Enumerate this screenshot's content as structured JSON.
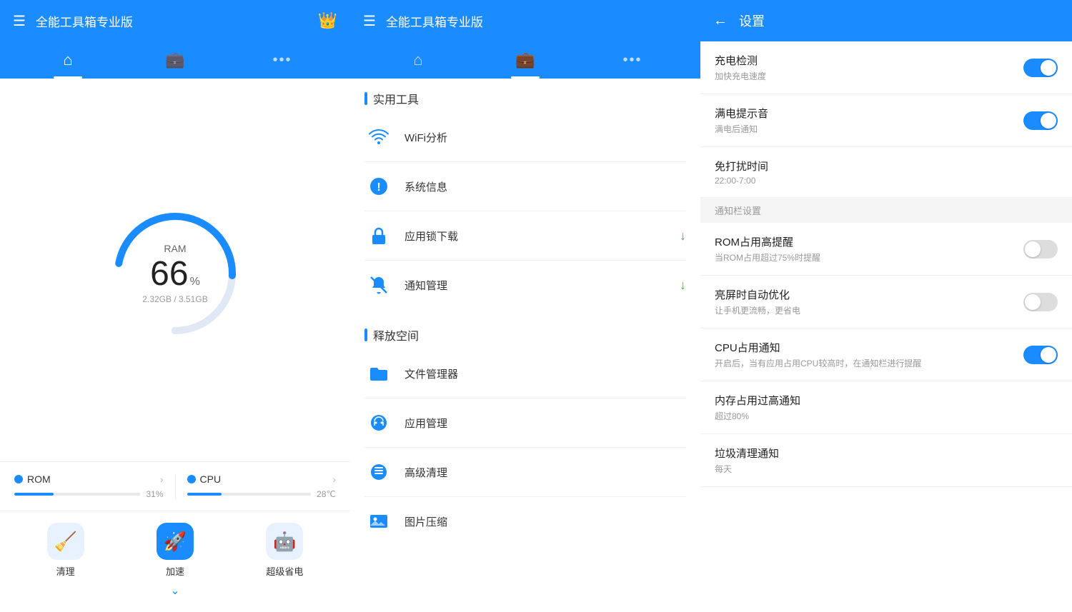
{
  "panel1": {
    "title": "全能工具箱专业版",
    "crown_icon": "👑",
    "nav": {
      "home_label": "home",
      "tools_label": "tools",
      "more_label": "more"
    },
    "ram": {
      "label": "RAM",
      "percent": "66",
      "unit": "%",
      "used": "2.32GB",
      "total": "3.51GB",
      "memory_text": "2.32GB / 3.51GB"
    },
    "rom": {
      "label": "ROM",
      "percent": 31,
      "percent_text": "31%"
    },
    "cpu": {
      "label": "CPU",
      "value": "28",
      "unit": "℃"
    },
    "actions": [
      {
        "id": "clean",
        "label": "清理",
        "icon": "🧹"
      },
      {
        "id": "speed",
        "label": "加速",
        "icon": "🚀",
        "accent": true
      },
      {
        "id": "power",
        "label": "超级省电",
        "icon": "🤖"
      }
    ]
  },
  "panel2": {
    "title": "全能工具箱专业版",
    "sections": [
      {
        "id": "utilities",
        "title": "实用工具",
        "items": [
          {
            "id": "wifi",
            "name": "WiFi分析",
            "icon": "wifi",
            "badge": null
          },
          {
            "id": "sysinfo",
            "name": "系统信息",
            "icon": "info",
            "badge": null
          },
          {
            "id": "applock",
            "name": "应用锁下载",
            "icon": "lock",
            "badge": "download"
          },
          {
            "id": "notify",
            "name": "通知管理",
            "icon": "bell-off",
            "badge": "download"
          }
        ]
      },
      {
        "id": "storage",
        "title": "释放空间",
        "items": [
          {
            "id": "files",
            "name": "文件管理器",
            "icon": "folder",
            "badge": null
          },
          {
            "id": "apps",
            "name": "应用管理",
            "icon": "android",
            "badge": null
          },
          {
            "id": "clean",
            "name": "高级清理",
            "icon": "cleaner",
            "badge": null
          },
          {
            "id": "image",
            "name": "图片压缩",
            "icon": "image",
            "badge": null
          }
        ]
      }
    ]
  },
  "panel3": {
    "title": "设置",
    "back_label": "←",
    "settings": [
      {
        "id": "charge-detect",
        "name": "充电检测",
        "desc": "加快充电速度",
        "toggle": "on",
        "group": null
      },
      {
        "id": "full-sound",
        "name": "满电提示音",
        "desc": "满电后通知",
        "toggle": "on",
        "group": null
      },
      {
        "id": "dnd-time",
        "name": "免打扰时间",
        "desc": "22:00-7:00",
        "toggle": null,
        "group": null
      },
      {
        "id": "notify-settings-header",
        "name": "通知栏设置",
        "desc": null,
        "toggle": null,
        "group": "header"
      },
      {
        "id": "rom-notify",
        "name": "ROM占用高提醒",
        "desc": "当ROM占用超过75%时提醒",
        "toggle": "off",
        "group": null
      },
      {
        "id": "screen-optimize",
        "name": "亮屏时自动优化",
        "desc": "让手机更流畅，更省电",
        "toggle": "off",
        "group": null
      },
      {
        "id": "cpu-notify",
        "name": "CPU占用通知",
        "desc": "开启后，当有应用占用CPU较高时，在通知栏进行提醒",
        "toggle": "on",
        "group": null
      },
      {
        "id": "memory-notify",
        "name": "内存占用过高通知",
        "desc": "超过80%",
        "toggle": null,
        "group": null
      },
      {
        "id": "trash-notify",
        "name": "垃圾清理通知",
        "desc": "每天",
        "toggle": null,
        "group": null
      }
    ]
  }
}
